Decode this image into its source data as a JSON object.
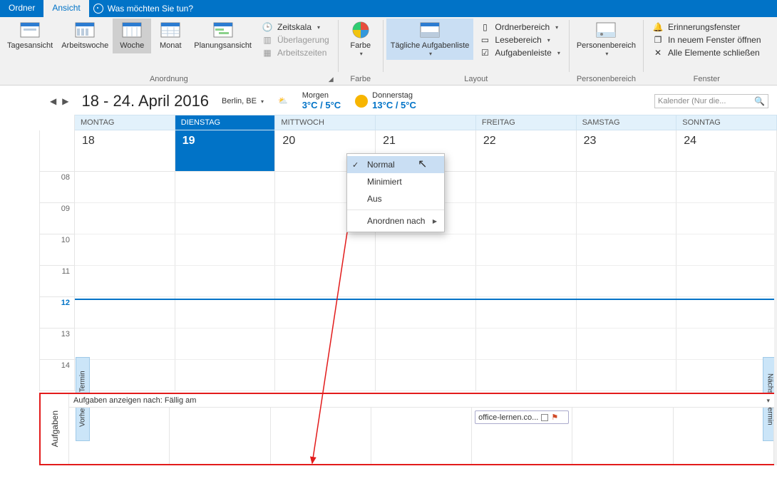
{
  "tabs": {
    "ordner": "Ordner",
    "ansicht": "Ansicht",
    "tell_me": "Was möchten Sie tun?"
  },
  "ribbon": {
    "anordnung": {
      "title": "Anordnung",
      "tagesansicht": "Tagesansicht",
      "arbeitswoche": "Arbeitswoche",
      "woche": "Woche",
      "monat": "Monat",
      "planungsansicht": "Planungsansicht",
      "zeitskala": "Zeitskala",
      "uberlagerung": "Überlagerung",
      "arbeitszeiten": "Arbeitszeiten"
    },
    "farbe": {
      "title": "Farbe",
      "button": "Farbe"
    },
    "taglich": {
      "title": "Layout",
      "button": "Tägliche Aufgabenliste"
    },
    "layout_items": {
      "ordnerbereich": "Ordnerbereich",
      "lesebereich": "Lesebereich",
      "aufgabenleiste": "Aufgabenleiste"
    },
    "personen": {
      "title": "Personenbereich",
      "button": "Personenbereich"
    },
    "fenster": {
      "title": "Fenster",
      "erinnerung": "Erinnerungsfenster",
      "neu": "In neuem Fenster öffnen",
      "schliessen": "Alle Elemente schließen"
    }
  },
  "dropdown": {
    "normal": "Normal",
    "minimiert": "Minimiert",
    "aus": "Aus",
    "anordnen": "Anordnen nach"
  },
  "header": {
    "date_range": "18 - 24. April 2016",
    "city": "Berlin, BE",
    "morgen_label": "Morgen",
    "morgen_temp": "3°C / 5°C",
    "donnerstag_label": "Donnerstag",
    "donnerstag_temp": "13°C / 5°C",
    "search_placeholder": "Kalender (Nur die..."
  },
  "days": {
    "labels": [
      "MONTAG",
      "DIENSTAG",
      "MITTWOCH",
      "",
      "FREITAG",
      "SAMSTAG",
      "SONNTAG"
    ],
    "numbers": [
      "18",
      "19",
      "20",
      "21",
      "22",
      "23",
      "24"
    ],
    "active_index": 1
  },
  "hours": [
    "08",
    "09",
    "10",
    "11",
    "12",
    "13",
    "14"
  ],
  "now_hour_index": 4,
  "nav": {
    "prev": "Vorheriger Termin",
    "next": "Nächster Termin"
  },
  "tasks": {
    "side_label": "Aufgaben",
    "header": "Aufgaben anzeigen nach: Fällig am",
    "item_text": "office-lernen.co..."
  }
}
